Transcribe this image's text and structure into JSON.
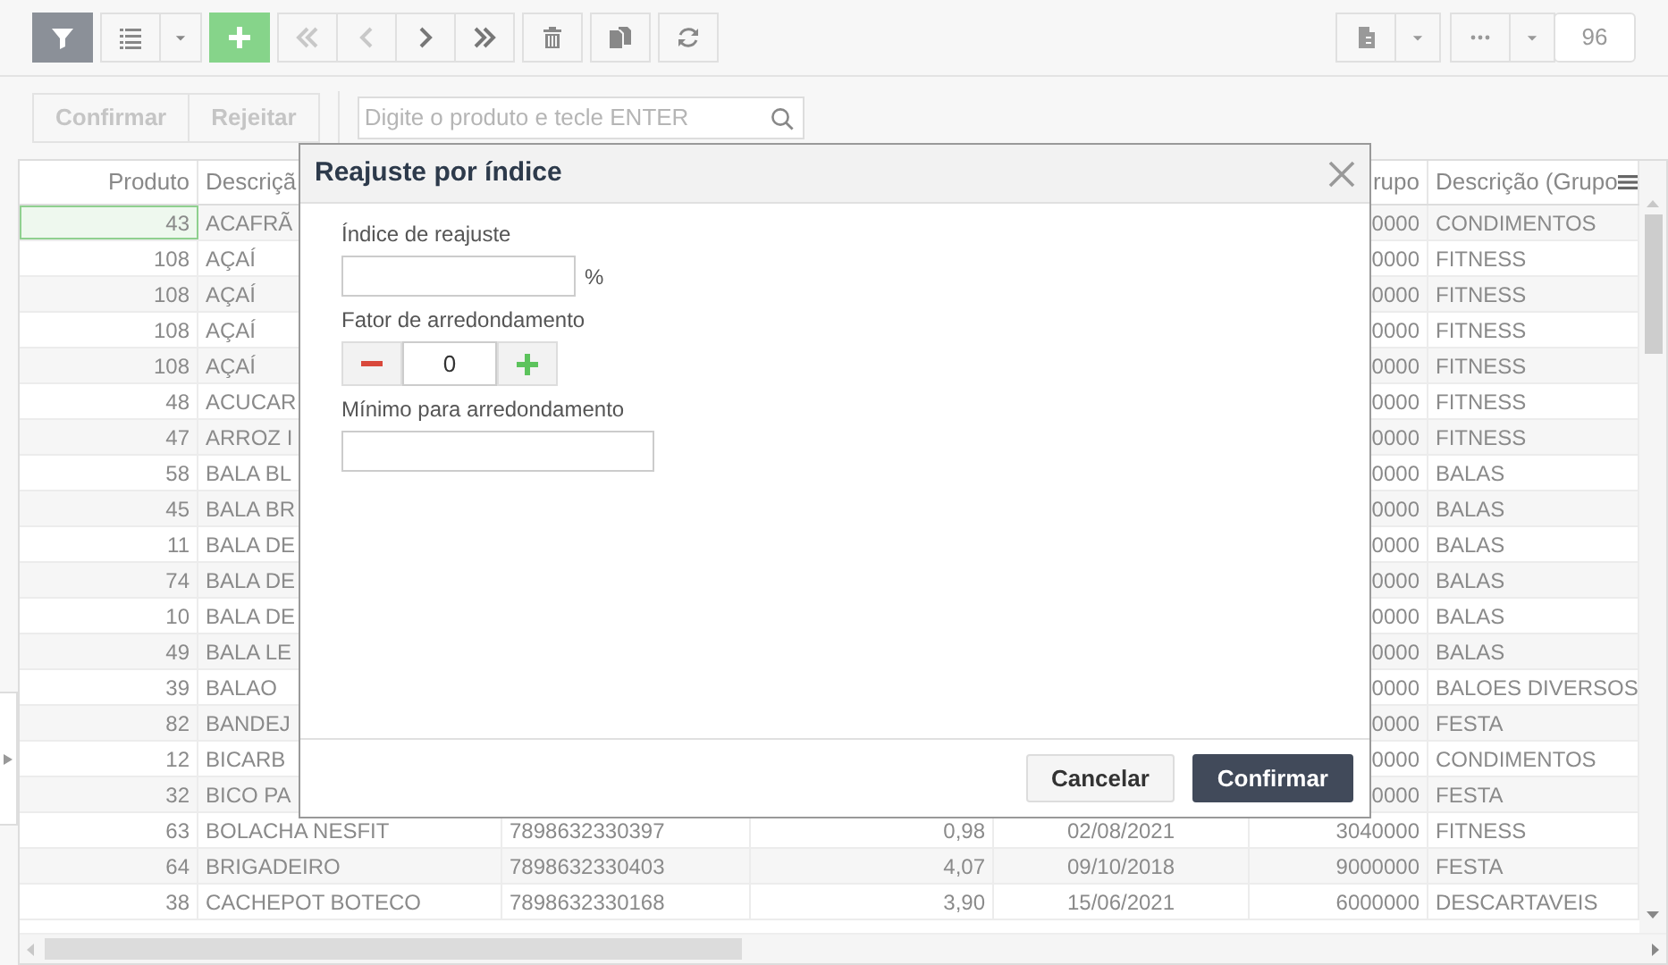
{
  "toolbar": {
    "buttons": [
      {
        "kind": "filter",
        "active": true
      },
      {
        "kind": "list",
        "active": false
      },
      {
        "kind": "caret",
        "active": false
      },
      {
        "kind": "add",
        "active": false
      },
      {
        "kind": "first",
        "active": false
      },
      {
        "kind": "prev",
        "active": false
      },
      {
        "kind": "next",
        "active": false
      },
      {
        "kind": "last",
        "active": false
      },
      {
        "kind": "delete",
        "active": false
      },
      {
        "kind": "copy",
        "active": false
      },
      {
        "kind": "refresh",
        "active": false
      }
    ],
    "right_buttons": [
      {
        "kind": "document"
      },
      {
        "kind": "caret"
      },
      {
        "kind": "more"
      },
      {
        "kind": "caret"
      }
    ],
    "count": "96"
  },
  "actions": [
    {
      "label": "Confirmar",
      "disabled": true
    },
    {
      "label": "Rejeitar",
      "disabled": true
    }
  ],
  "search": {
    "placeholder": "Digite o produto e tecle ENTER"
  },
  "table": {
    "columns": [
      "Produto",
      "Descriçã",
      "",
      "",
      "",
      "rupo",
      "Descrição (Grupo"
    ],
    "rows": [
      {
        "cells": [
          "43",
          "ACAFRÃ",
          "",
          "",
          "",
          "0000",
          "CONDIMENTOS"
        ],
        "focused": true
      },
      {
        "cells": [
          "108",
          "AÇAÍ",
          "",
          "",
          "",
          "0000",
          "FITNESS"
        ],
        "focused": false
      },
      {
        "cells": [
          "108",
          "AÇAÍ",
          "",
          "",
          "",
          "0000",
          "FITNESS"
        ],
        "focused": false
      },
      {
        "cells": [
          "108",
          "AÇAÍ",
          "",
          "",
          "",
          "0000",
          "FITNESS"
        ],
        "focused": false
      },
      {
        "cells": [
          "108",
          "AÇAÍ",
          "",
          "",
          "",
          "0000",
          "FITNESS"
        ],
        "focused": false
      },
      {
        "cells": [
          "48",
          "ACUCAR",
          "",
          "",
          "",
          "0000",
          "FITNESS"
        ],
        "focused": false
      },
      {
        "cells": [
          "47",
          "ARROZ I",
          "",
          "",
          "",
          "0000",
          "FITNESS"
        ],
        "focused": false
      },
      {
        "cells": [
          "58",
          "BALA BL",
          "",
          "",
          "",
          "0000",
          "BALAS"
        ],
        "focused": false
      },
      {
        "cells": [
          "45",
          "BALA BR",
          "",
          "",
          "",
          "0000",
          "BALAS"
        ],
        "focused": false
      },
      {
        "cells": [
          "11",
          "BALA DE",
          "",
          "",
          "",
          "0000",
          "BALAS"
        ],
        "focused": false
      },
      {
        "cells": [
          "74",
          "BALA DE",
          "",
          "",
          "",
          "0000",
          "BALAS"
        ],
        "focused": false
      },
      {
        "cells": [
          "10",
          "BALA DE",
          "",
          "",
          "",
          "0000",
          "BALAS"
        ],
        "focused": false
      },
      {
        "cells": [
          "49",
          "BALA LE",
          "",
          "",
          "",
          "0000",
          "BALAS"
        ],
        "focused": false
      },
      {
        "cells": [
          "39",
          "BALAO",
          "",
          "",
          "",
          "0000",
          "BALOES DIVERSOS"
        ],
        "focused": false
      },
      {
        "cells": [
          "82",
          "BANDEJ",
          "",
          "",
          "",
          "0000",
          "FESTA"
        ],
        "focused": false
      },
      {
        "cells": [
          "12",
          "BICARB",
          "",
          "",
          "",
          "0000",
          "CONDIMENTOS"
        ],
        "focused": false
      },
      {
        "cells": [
          "32",
          "BICO PA",
          "",
          "",
          "",
          "0000",
          "FESTA"
        ],
        "focused": false
      },
      {
        "cells": [
          "63",
          "BOLACHA NESFIT",
          "7898632330397",
          "0,98",
          "02/08/2021",
          "3040000",
          "FITNESS"
        ],
        "focused": false
      },
      {
        "cells": [
          "64",
          "BRIGADEIRO",
          "7898632330403",
          "4,07",
          "09/10/2018",
          "9000000",
          "FESTA"
        ],
        "focused": false
      },
      {
        "cells": [
          "38",
          "CACHEPOT BOTECO",
          "7898632330168",
          "3,90",
          "15/06/2021",
          "6000000",
          "DESCARTAVEIS"
        ],
        "focused": false
      }
    ]
  },
  "dialog": {
    "title": "Reajuste por índice",
    "fields": [
      {
        "kind": "percent",
        "label": "Índice de reajuste",
        "suffix": "%"
      },
      {
        "kind": "stepper",
        "label": "Fator de arredondamento",
        "value": "0"
      },
      {
        "kind": "text",
        "label": "Mínimo para arredondamento"
      }
    ],
    "buttons": [
      {
        "label": "Cancelar",
        "primary": false
      },
      {
        "label": "Confirmar",
        "primary": true
      }
    ]
  }
}
